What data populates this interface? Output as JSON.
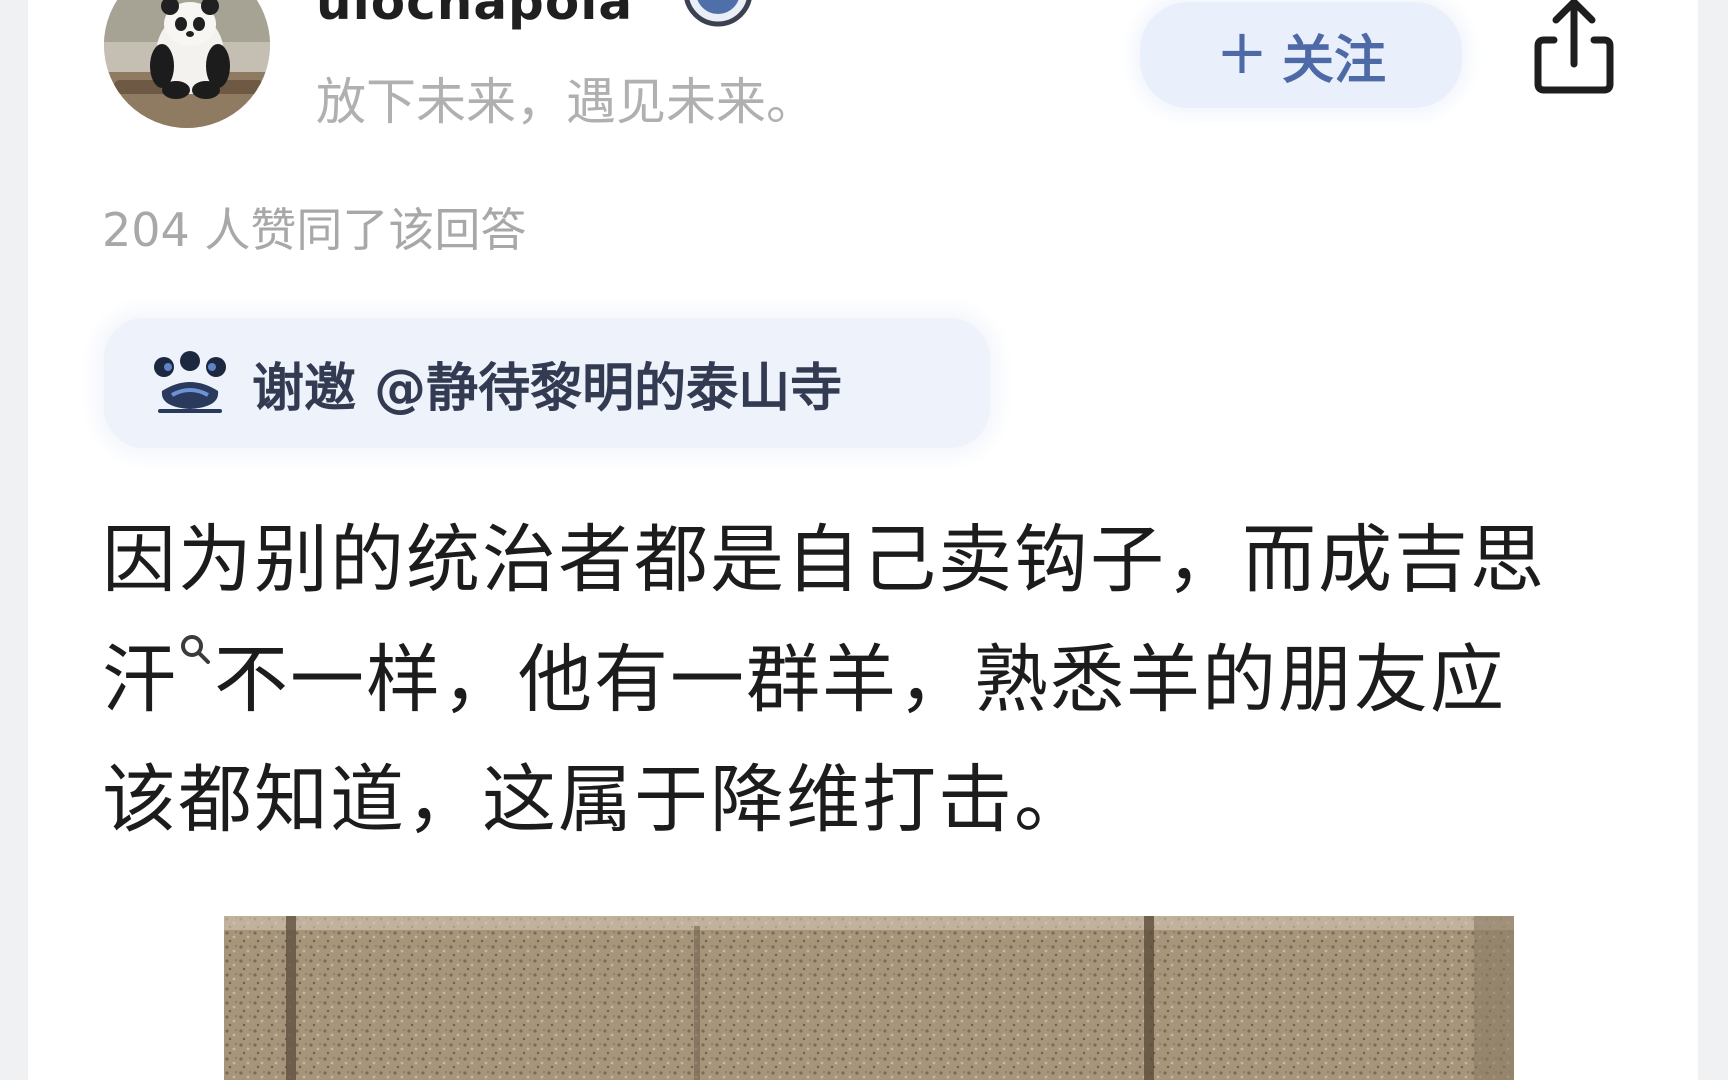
{
  "author": {
    "name": "ulochapola",
    "signature": "放下未来，遇见未来。"
  },
  "follow_button": {
    "plus": "+",
    "label": "关注"
  },
  "approval_text": "204 人赞同了该回答",
  "invitation": {
    "text": "谢邀 @静待黎明的泰山寺"
  },
  "answer": {
    "line1": "因为别的统治者都是自己卖钩子，而成吉思",
    "line2_a": "汗",
    "line2_b": "不一样，他有一群羊，熟悉羊的朋友应",
    "line3": "该都知道，这属于降维打击。"
  },
  "icons": {
    "verified": "verified-badge-icon",
    "share": "share-icon",
    "invite": "invite-icon",
    "search_hint": "search-hint-icon"
  },
  "colors": {
    "follow_text": "#4e6aa6",
    "follow_bg": "#eaf0fb",
    "muted_text": "#b0b0b0"
  }
}
